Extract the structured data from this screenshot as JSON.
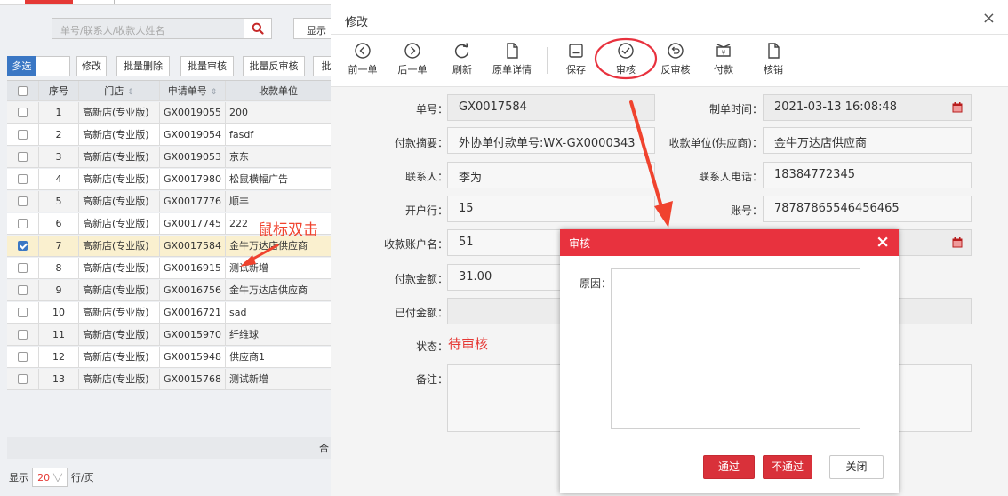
{
  "colors": {
    "accent_red": "#e8323e",
    "primary_blue": "#3a77c4",
    "status_red": "#e53935",
    "annotation_red": "#f0432e"
  },
  "list": {
    "search_placeholder": "单号/联系人/收款人姓名",
    "show_label": "显示",
    "multi_select": "多选",
    "toolbar": [
      "修改",
      "批量删除",
      "批量审核",
      "批量反审核",
      "批"
    ],
    "columns": {
      "no": "序号",
      "store": "门店",
      "apply_no": "申请单号",
      "payee": "收款单位"
    },
    "rows": [
      {
        "no": "1",
        "store": "高新店(专业版)",
        "apply_no": "GX0019055",
        "payee": "200",
        "checked": false
      },
      {
        "no": "2",
        "store": "高新店(专业版)",
        "apply_no": "GX0019054",
        "payee": "fasdf",
        "checked": false
      },
      {
        "no": "3",
        "store": "高新店(专业版)",
        "apply_no": "GX0019053",
        "payee": "京东",
        "checked": false
      },
      {
        "no": "4",
        "store": "高新店(专业版)",
        "apply_no": "GX0017980",
        "payee": "松鼠横幅广告",
        "checked": false
      },
      {
        "no": "5",
        "store": "高新店(专业版)",
        "apply_no": "GX0017776",
        "payee": "顺丰",
        "checked": false
      },
      {
        "no": "6",
        "store": "高新店(专业版)",
        "apply_no": "GX0017745",
        "payee": "222",
        "checked": false
      },
      {
        "no": "7",
        "store": "高新店(专业版)",
        "apply_no": "GX0017584",
        "payee": "金牛万达店供应商",
        "checked": true
      },
      {
        "no": "8",
        "store": "高新店(专业版)",
        "apply_no": "GX0016915",
        "payee": "测试新增",
        "checked": false
      },
      {
        "no": "9",
        "store": "高新店(专业版)",
        "apply_no": "GX0016756",
        "payee": "金牛万达店供应商",
        "checked": false
      },
      {
        "no": "10",
        "store": "高新店(专业版)",
        "apply_no": "GX0016721",
        "payee": "sad",
        "checked": false
      },
      {
        "no": "11",
        "store": "高新店(专业版)",
        "apply_no": "GX0015970",
        "payee": "纤维球",
        "checked": false
      },
      {
        "no": "12",
        "store": "高新店(专业版)",
        "apply_no": "GX0015948",
        "payee": "供应商1",
        "checked": false
      },
      {
        "no": "13",
        "store": "高新店(专业版)",
        "apply_no": "GX0015768",
        "payee": "测试新增",
        "checked": false
      }
    ],
    "footer_partial": "合",
    "pager": {
      "show": "显示",
      "page_size": "20",
      "per_page": "行/页"
    }
  },
  "annotation": {
    "double_click": "鼠标双击"
  },
  "edit": {
    "title": "修改",
    "close": "×",
    "toolbar": [
      {
        "label": "前一单",
        "icon": "chevron-left-circle-icon"
      },
      {
        "label": "后一单",
        "icon": "chevron-right-circle-icon"
      },
      {
        "label": "刷新",
        "icon": "refresh-icon"
      },
      {
        "label": "原单详情",
        "icon": "document-icon"
      },
      {
        "label": "保存",
        "icon": "save-icon"
      },
      {
        "label": "审核",
        "icon": "check-circle-icon"
      },
      {
        "label": "反审核",
        "icon": "undo-circle-icon"
      },
      {
        "label": "付款",
        "icon": "payment-icon"
      },
      {
        "label": "核销",
        "icon": "writeoff-document-icon"
      }
    ],
    "fields": {
      "bill_no": {
        "label": "单号：",
        "value": "GX0017584"
      },
      "create_time": {
        "label": "制单时间：",
        "value": "2021-03-13 16:08:48"
      },
      "pay_summary": {
        "label": "付款摘要：",
        "value": "外协单付款单号:WX-GX0000343"
      },
      "payee_unit": {
        "label": "收款单位(供应商)：",
        "value": "金牛万达店供应商"
      },
      "contact": {
        "label": "联系人：",
        "value": "李为"
      },
      "contact_phone": {
        "label": "联系人电话：",
        "value": "18384772345"
      },
      "bank": {
        "label": "开户行：",
        "value": "15"
      },
      "account_no": {
        "label": "账号：",
        "value": "78787865546456465"
      },
      "account_name": {
        "label": "收款账户名：",
        "value": "51"
      },
      "pay_amount": {
        "label": "付款金额：",
        "value": "31.00"
      },
      "paid_amount": {
        "label": "已付金额：",
        "value": ""
      },
      "status": {
        "label": "状态：",
        "value": "待审核"
      },
      "remark": {
        "label": "备注：",
        "value": ""
      }
    }
  },
  "audit_modal": {
    "title": "审核",
    "close": "×",
    "reason_label": "原因：",
    "reason_value": "",
    "buttons": {
      "pass": "通过",
      "reject": "不通过",
      "close": "关闭"
    }
  }
}
